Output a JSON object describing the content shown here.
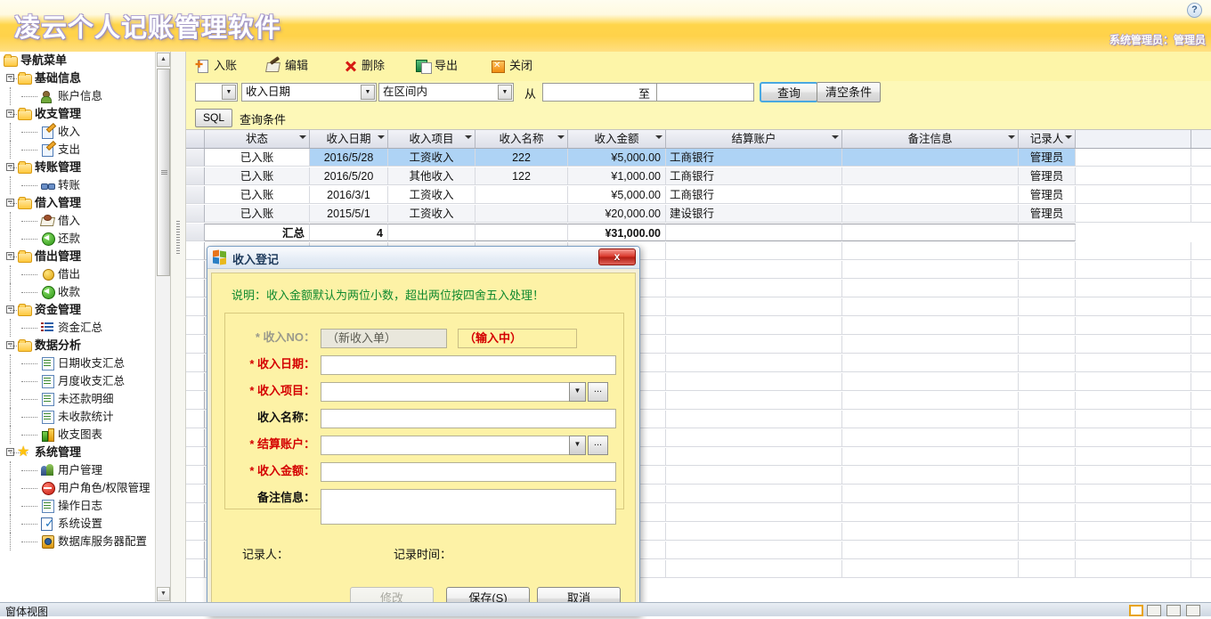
{
  "header": {
    "title": "凌云个人记账管理软件",
    "user_info": "系统管理员：管理员",
    "help_icon": "?"
  },
  "sidebar": {
    "root_label": "导航菜单",
    "items": [
      {
        "label": "基础信息",
        "level": "group",
        "icon": "folder-icon"
      },
      {
        "label": "账户信息",
        "level": "leaf",
        "icon": "person-add-icon"
      },
      {
        "label": "收支管理",
        "level": "group",
        "icon": "folder-icon"
      },
      {
        "label": "收入",
        "level": "leaf",
        "icon": "note-edit-icon"
      },
      {
        "label": "支出",
        "level": "leaf",
        "icon": "note-edit-icon"
      },
      {
        "label": "转账管理",
        "level": "group",
        "icon": "folder-icon"
      },
      {
        "label": "转账",
        "level": "leaf",
        "icon": "link-icon"
      },
      {
        "label": "借入管理",
        "level": "group",
        "icon": "folder-icon"
      },
      {
        "label": "借入",
        "level": "leaf",
        "icon": "money-icon"
      },
      {
        "label": "还款",
        "level": "leaf",
        "icon": "green-back-arrow-icon"
      },
      {
        "label": "借出管理",
        "level": "group",
        "icon": "folder-icon"
      },
      {
        "label": "借出",
        "level": "leaf",
        "icon": "coin-icon"
      },
      {
        "label": "收款",
        "level": "leaf",
        "icon": "green-back-arrow-icon"
      },
      {
        "label": "资金管理",
        "level": "group",
        "icon": "folder-icon"
      },
      {
        "label": "资金汇总",
        "level": "leaf",
        "icon": "list-icon"
      },
      {
        "label": "数据分析",
        "level": "group",
        "icon": "folder-icon"
      },
      {
        "label": "日期收支汇总",
        "level": "leaf",
        "icon": "report-icon"
      },
      {
        "label": "月度收支汇总",
        "level": "leaf",
        "icon": "report-icon"
      },
      {
        "label": "未还款明细",
        "level": "leaf",
        "icon": "report-icon"
      },
      {
        "label": "未收款统计",
        "level": "leaf",
        "icon": "report-icon"
      },
      {
        "label": "收支图表",
        "level": "leaf",
        "icon": "bar-chart-icon"
      },
      {
        "label": "系统管理",
        "level": "group",
        "icon": "star-icon"
      },
      {
        "label": "用户管理",
        "level": "leaf",
        "icon": "users-icon"
      },
      {
        "label": "用户角色/权限管理",
        "level": "leaf",
        "icon": "deny-icon"
      },
      {
        "label": "操作日志",
        "level": "leaf",
        "icon": "report-icon"
      },
      {
        "label": "系统设置",
        "level": "leaf",
        "icon": "settings-icon"
      },
      {
        "label": "数据库服务器配置",
        "level": "leaf",
        "icon": "database-icon"
      }
    ]
  },
  "toolbar": {
    "buttons": [
      {
        "label": "入账",
        "icon": "add-record-icon"
      },
      {
        "label": "编辑",
        "icon": "edit-icon"
      },
      {
        "label": "删除",
        "icon": "delete-icon"
      },
      {
        "label": "导出",
        "icon": "export-excel-icon"
      },
      {
        "label": "关闭",
        "icon": "close-icon"
      }
    ]
  },
  "filter": {
    "logic_value": "",
    "field_value": "收入日期",
    "operator_value": "在区间内",
    "from_label": "从",
    "from_value": "",
    "to_label": "至",
    "to_value": "",
    "query_button": "查询",
    "clear_button": "清空条件"
  },
  "sql_bar": {
    "button": "SQL",
    "text": "查询条件"
  },
  "grid": {
    "columns": [
      "状态",
      "收入日期",
      "收入项目",
      "收入名称",
      "收入金额",
      "结算账户",
      "备注信息",
      "记录人"
    ],
    "rows": [
      {
        "状态": "已入账",
        "收入日期": "2016/5/28",
        "收入项目": "工资收入",
        "收入名称": "222",
        "收入金额": "¥5,000.00",
        "结算账户": "工商银行",
        "备注信息": "",
        "记录人": "管理员"
      },
      {
        "状态": "已入账",
        "收入日期": "2016/5/20",
        "收入项目": "其他收入",
        "收入名称": "122",
        "收入金额": "¥1,000.00",
        "结算账户": "工商银行",
        "备注信息": "",
        "记录人": "管理员"
      },
      {
        "状态": "已入账",
        "收入日期": "2016/3/1",
        "收入项目": "工资收入",
        "收入名称": "",
        "收入金额": "¥5,000.00",
        "结算账户": "工商银行",
        "备注信息": "",
        "记录人": "管理员"
      },
      {
        "状态": "已入账",
        "收入日期": "2015/5/1",
        "收入项目": "工资收入",
        "收入名称": "",
        "收入金额": "¥20,000.00",
        "结算账户": "建设银行",
        "备注信息": "",
        "记录人": "管理员"
      }
    ],
    "summary": {
      "label": "汇总",
      "count": "4",
      "amount": "¥31,000.00"
    }
  },
  "dialog": {
    "title": "收入登记",
    "close_label": "x",
    "note": "说明：收入金额默认为两位小数，超出两位按四舍五入处理！",
    "fields": [
      {
        "label": "* 收入NO：",
        "value": "（新收入单）",
        "status": "（输入中）",
        "type": "readonly"
      },
      {
        "label": "* 收入日期：",
        "value": "",
        "type": "text"
      },
      {
        "label": "* 收入项目：",
        "value": "",
        "type": "combo",
        "dots": "..."
      },
      {
        "label": "收入名称：",
        "value": "",
        "type": "text"
      },
      {
        "label": "* 结算账户：",
        "value": "",
        "type": "combo",
        "dots": "..."
      },
      {
        "label": "* 收入金额：",
        "value": "",
        "type": "text"
      },
      {
        "label": "备注信息：",
        "value": "",
        "type": "textarea"
      }
    ],
    "meta": {
      "recorder_label": "记录人：",
      "recorder_value": "",
      "time_label": "记录时间：",
      "time_value": ""
    },
    "buttons": [
      {
        "label": "修改",
        "disabled": true
      },
      {
        "label": "保存(S)",
        "disabled": false
      },
      {
        "label": "取消",
        "disabled": false
      }
    ]
  },
  "statusbar": {
    "text": "窗体视图"
  }
}
